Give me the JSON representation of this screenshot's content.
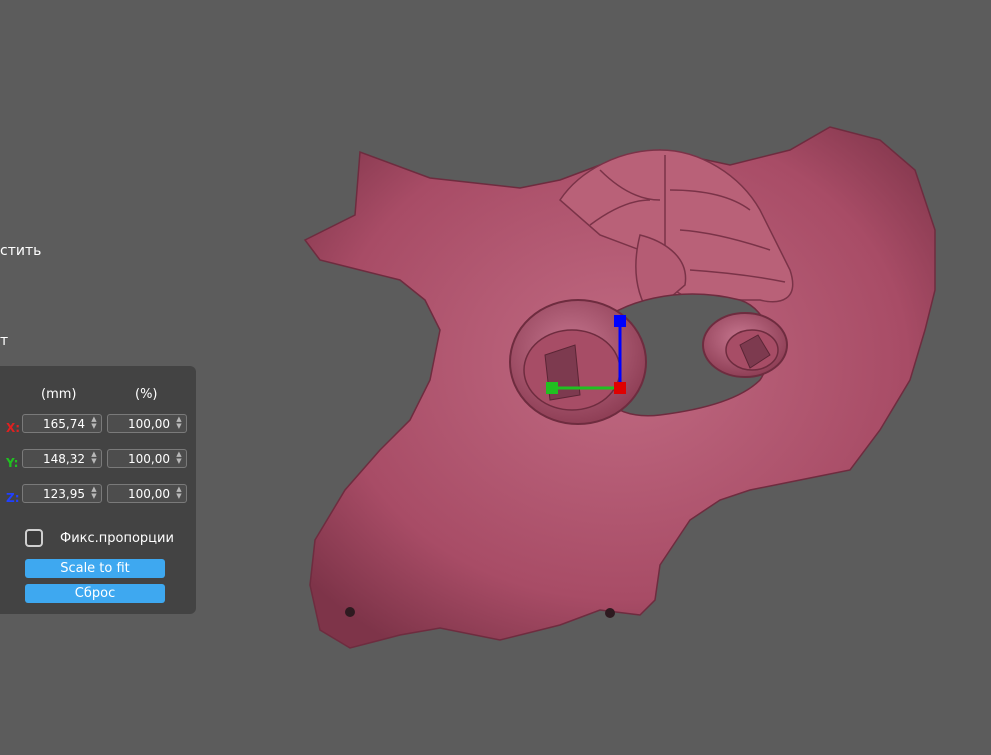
{
  "sidebar": {
    "partial_label_1": "стить",
    "partial_label_2": "т"
  },
  "scale_panel": {
    "col_mm": "(mm)",
    "col_pct": "(%)",
    "rows": [
      {
        "axis": "X:",
        "axis_color": "#e02020",
        "mm": "165,74",
        "pct": "100,00"
      },
      {
        "axis": "Y:",
        "axis_color": "#20c020",
        "mm": "148,32",
        "pct": "100,00"
      },
      {
        "axis": "Z:",
        "axis_color": "#2040ff",
        "mm": "123,95",
        "pct": "100,00"
      }
    ],
    "lock_proportions_label": "Фикс.пропорции",
    "lock_proportions_checked": false,
    "scale_to_fit_label": "Scale to fit",
    "reset_label": "Сброс"
  },
  "gizmo": {
    "x_color": "#20c020",
    "z_color": "#0000ff",
    "origin_color": "#e00000"
  },
  "model": {
    "fill_color": "#b0566f"
  }
}
